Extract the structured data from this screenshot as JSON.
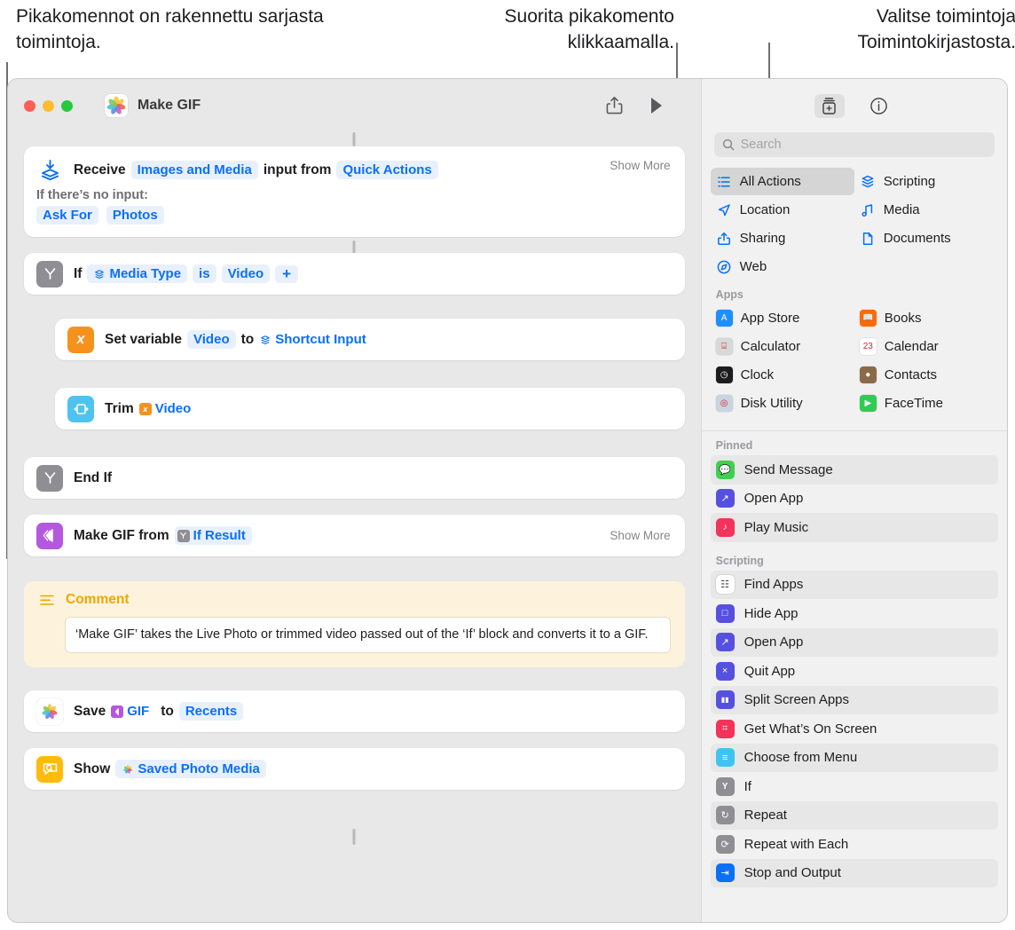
{
  "callouts": {
    "left": "Pikakomennot on rakennettu sarjasta toimintoja.",
    "middle": "Suorita pikakomento klikkaamalla.",
    "right": "Valitse toimintoja Toimintokirjastosta."
  },
  "window": {
    "title": "Make GIF",
    "app_icon": "photos-icon",
    "traffic_lights": [
      "close-button",
      "minimize-button",
      "zoom-button"
    ],
    "toolbar": {
      "share": "share-icon",
      "run": "run-play-icon",
      "action_library": "action-library-icon",
      "info": "info-icon"
    }
  },
  "flow": {
    "show_more_label": "Show More",
    "receive": {
      "word1": "Receive",
      "token_input": "Images and Media",
      "word2": "input from",
      "token_source": "Quick Actions",
      "sub_label": "If there’s no input:",
      "sub_token1": "Ask For",
      "sub_token2": "Photos"
    },
    "if_action": {
      "word1": "If",
      "token_var": "Media Type",
      "token_op": "is",
      "token_val": "Video",
      "token_add": "+"
    },
    "set_variable": {
      "word1": "Set variable",
      "token_name": "Video",
      "word2": "to",
      "token_value": "Shortcut Input"
    },
    "trim": {
      "word1": "Trim",
      "token_value": "Video"
    },
    "end_if": {
      "word1": "End If"
    },
    "make_gif": {
      "word1": "Make GIF from",
      "token_value": "If Result"
    },
    "comment": {
      "title": "Comment",
      "body": "‘Make GIF’ takes the Live Photo or trimmed video passed out of the ‘If’ block and converts it to a GIF."
    },
    "save": {
      "word1": "Save",
      "token_value": "GIF",
      "word2": "to",
      "token_dest": "Recents"
    },
    "show": {
      "word1": "Show",
      "token_value": "Saved Photo Media"
    }
  },
  "library": {
    "search_placeholder": "Search",
    "search_value": "",
    "categories": [
      {
        "label": "All Actions",
        "icon": "list-icon",
        "selected": true,
        "color": "#0a70f5"
      },
      {
        "label": "Scripting",
        "icon": "scripting-icon",
        "selected": false,
        "color": "#0a70f5"
      },
      {
        "label": "Location",
        "icon": "location-icon",
        "selected": false,
        "color": "#0a70f5"
      },
      {
        "label": "Media",
        "icon": "music-note-icon",
        "selected": false,
        "color": "#0a70f5"
      },
      {
        "label": "Sharing",
        "icon": "share-icon",
        "selected": false,
        "color": "#0a70f5"
      },
      {
        "label": "Documents",
        "icon": "document-icon",
        "selected": false,
        "color": "#0a70f5"
      },
      {
        "label": "Web",
        "icon": "safari-icon",
        "selected": false,
        "color": "#0a70f5"
      }
    ],
    "apps_header": "Apps",
    "apps": [
      {
        "label": "App Store",
        "icon": "app-store-icon",
        "color": "#1e8fff"
      },
      {
        "label": "Books",
        "icon": "books-icon",
        "color": "#ff6a00"
      },
      {
        "label": "Calculator",
        "icon": "calculator-icon",
        "color": "#d8d8d8"
      },
      {
        "label": "Calendar",
        "icon": "calendar-icon",
        "color": "#ffffff"
      },
      {
        "label": "Clock",
        "icon": "clock-icon",
        "color": "#1c1c1e"
      },
      {
        "label": "Contacts",
        "icon": "contacts-icon",
        "color": "#8b6a4a"
      },
      {
        "label": "Disk Utility",
        "icon": "disk-utility-icon",
        "color": "#c9d4e0"
      },
      {
        "label": "FaceTime",
        "icon": "facetime-icon",
        "color": "#2ecc55"
      }
    ],
    "pinned_header": "Pinned",
    "pinned": [
      {
        "label": "Send Message",
        "icon": "messages-icon",
        "color": "#3fd04f"
      },
      {
        "label": "Open App",
        "icon": "open-app-icon",
        "color": "#5650e0"
      },
      {
        "label": "Play Music",
        "icon": "music-icon",
        "color": "#f4335a"
      }
    ],
    "scripting_header": "Scripting",
    "scripting": [
      {
        "label": "Find Apps",
        "icon": "find-apps-icon",
        "color": "#ffffff"
      },
      {
        "label": "Hide App",
        "icon": "hide-app-icon",
        "color": "#5650e0"
      },
      {
        "label": "Open App",
        "icon": "open-app-icon",
        "color": "#5650e0"
      },
      {
        "label": "Quit App",
        "icon": "quit-app-icon",
        "color": "#5650e0"
      },
      {
        "label": "Split Screen Apps",
        "icon": "split-screen-icon",
        "color": "#5650e0"
      },
      {
        "label": "Get What’s On Screen",
        "icon": "screen-icon",
        "color": "#f4335a"
      },
      {
        "label": "Choose from Menu",
        "icon": "menu-icon",
        "color": "#41c3f2"
      },
      {
        "label": "If",
        "icon": "if-branch-icon",
        "color": "#8e8e93"
      },
      {
        "label": "Repeat",
        "icon": "repeat-icon",
        "color": "#8e8e93"
      },
      {
        "label": "Repeat with Each",
        "icon": "repeat-each-icon",
        "color": "#8e8e93"
      },
      {
        "label": "Stop and Output",
        "icon": "stop-output-icon",
        "color": "#0a70f5"
      }
    ]
  },
  "colors": {
    "accent_blue": "#0a70f5",
    "token_bg": "#e8f0fe",
    "orange": "#f5921e",
    "cyan": "#4ec3f0",
    "purple": "#b558e0",
    "gray": "#8e8e93",
    "yellow": "#ffbb0a",
    "comment_bg": "#fdf3dd"
  }
}
